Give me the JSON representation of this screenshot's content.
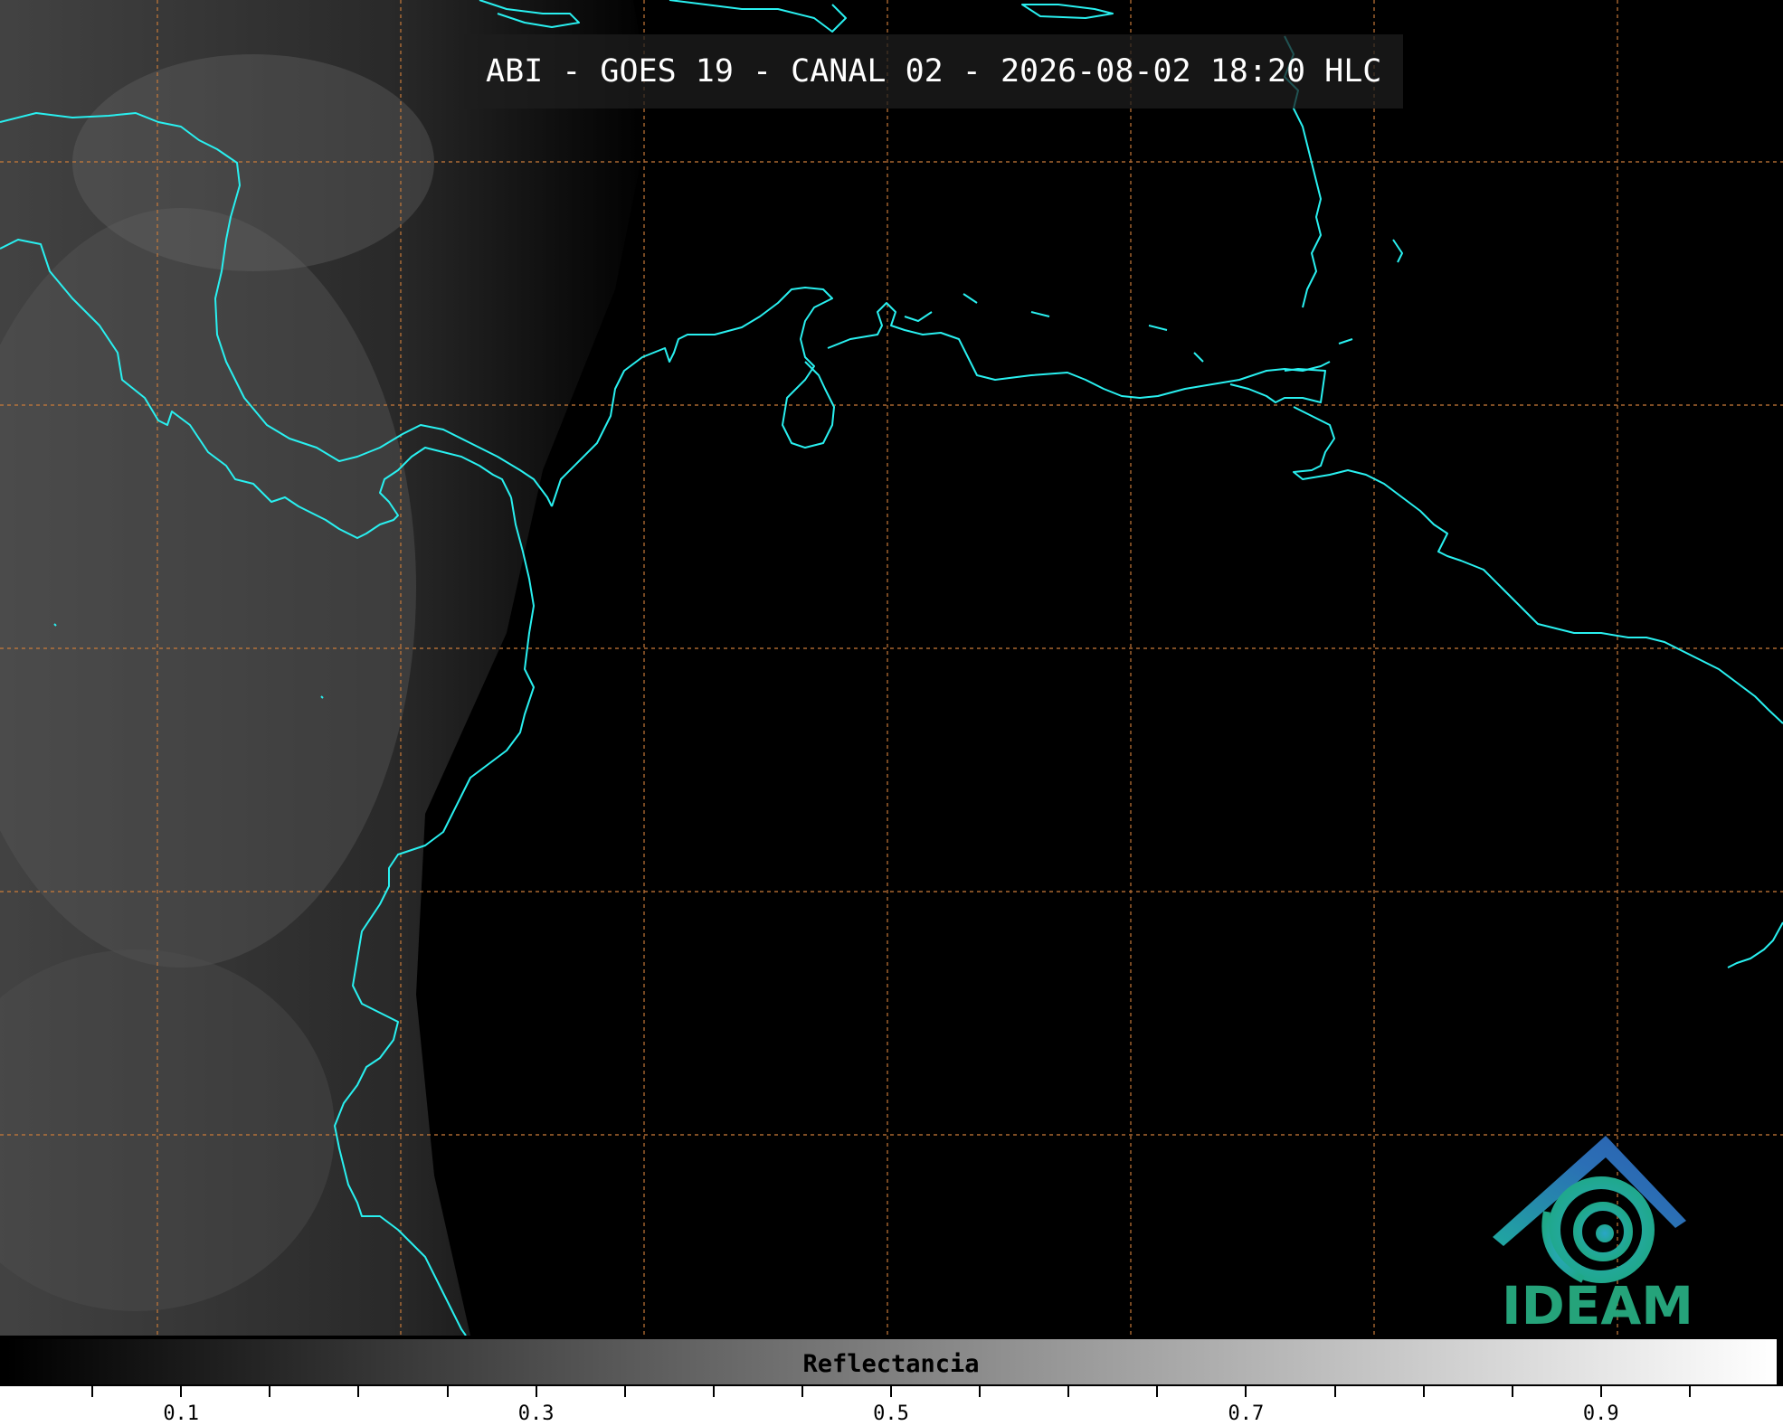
{
  "header": {
    "title": "ABI - GOES 19 - CANAL 02 - 2026-08-02 18:20 HLC"
  },
  "logo": {
    "text": "IDEAM",
    "icon": "ideam-logo-icon",
    "colors": {
      "roof": "#2b6fb5",
      "swirl": "#1fa8a0",
      "text": "#25a37a"
    }
  },
  "colorbar": {
    "label": "Reflectancia",
    "min": 0.0,
    "max": 1.0,
    "tick_labels": [
      "0.1",
      "0.3",
      "0.5",
      "0.7",
      "0.9"
    ],
    "tick_values": [
      0.1,
      0.3,
      0.5,
      0.7,
      0.9
    ]
  },
  "colors": {
    "coastline": "#29f0f0",
    "gridline": "#c87a3a",
    "background": "#000000"
  }
}
